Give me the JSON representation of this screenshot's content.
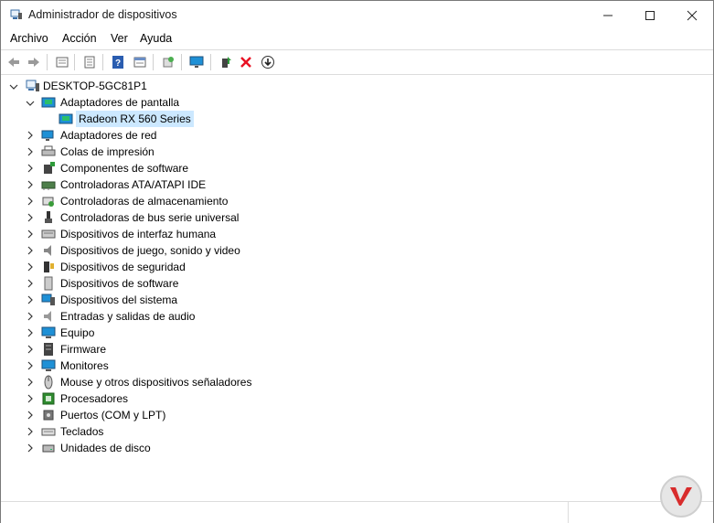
{
  "window": {
    "title": "Administrador de dispositivos"
  },
  "title_controls": {
    "minimize": "—",
    "maximize": "☐",
    "close": "✕"
  },
  "menu": [
    "Archivo",
    "Acción",
    "Ver",
    "Ayuda"
  ],
  "toolbar": {
    "buttons": [
      "back-icon",
      "forward-icon",
      "properties-icon",
      "view-icon",
      "help-icon",
      "details-icon",
      "scan-hardware-icon",
      "monitor-icon",
      "update-driver-icon",
      "uninstall-icon",
      "disable-icon"
    ]
  },
  "tree": {
    "root": "DESKTOP-5GC81P1",
    "expanded_category": "Adaptadores de pantalla",
    "selected_device": "Radeon RX 560 Series",
    "categories": [
      "Adaptadores de red",
      "Colas de impresión",
      "Componentes de software",
      "Controladoras ATA/ATAPI IDE",
      "Controladoras de almacenamiento",
      "Controladoras de bus serie universal",
      "Dispositivos de interfaz humana",
      "Dispositivos de juego, sonido y video",
      "Dispositivos de seguridad",
      "Dispositivos de software",
      "Dispositivos del sistema",
      "Entradas y salidas de audio",
      "Equipo",
      "Firmware",
      "Monitores",
      "Mouse y otros dispositivos señaladores",
      "Procesadores",
      "Puertos (COM y LPT)",
      "Teclados",
      "Unidades de disco"
    ]
  },
  "colors": {
    "accent": "#0067c0",
    "selection": "#cce8ff",
    "delete_red": "#e81123"
  }
}
